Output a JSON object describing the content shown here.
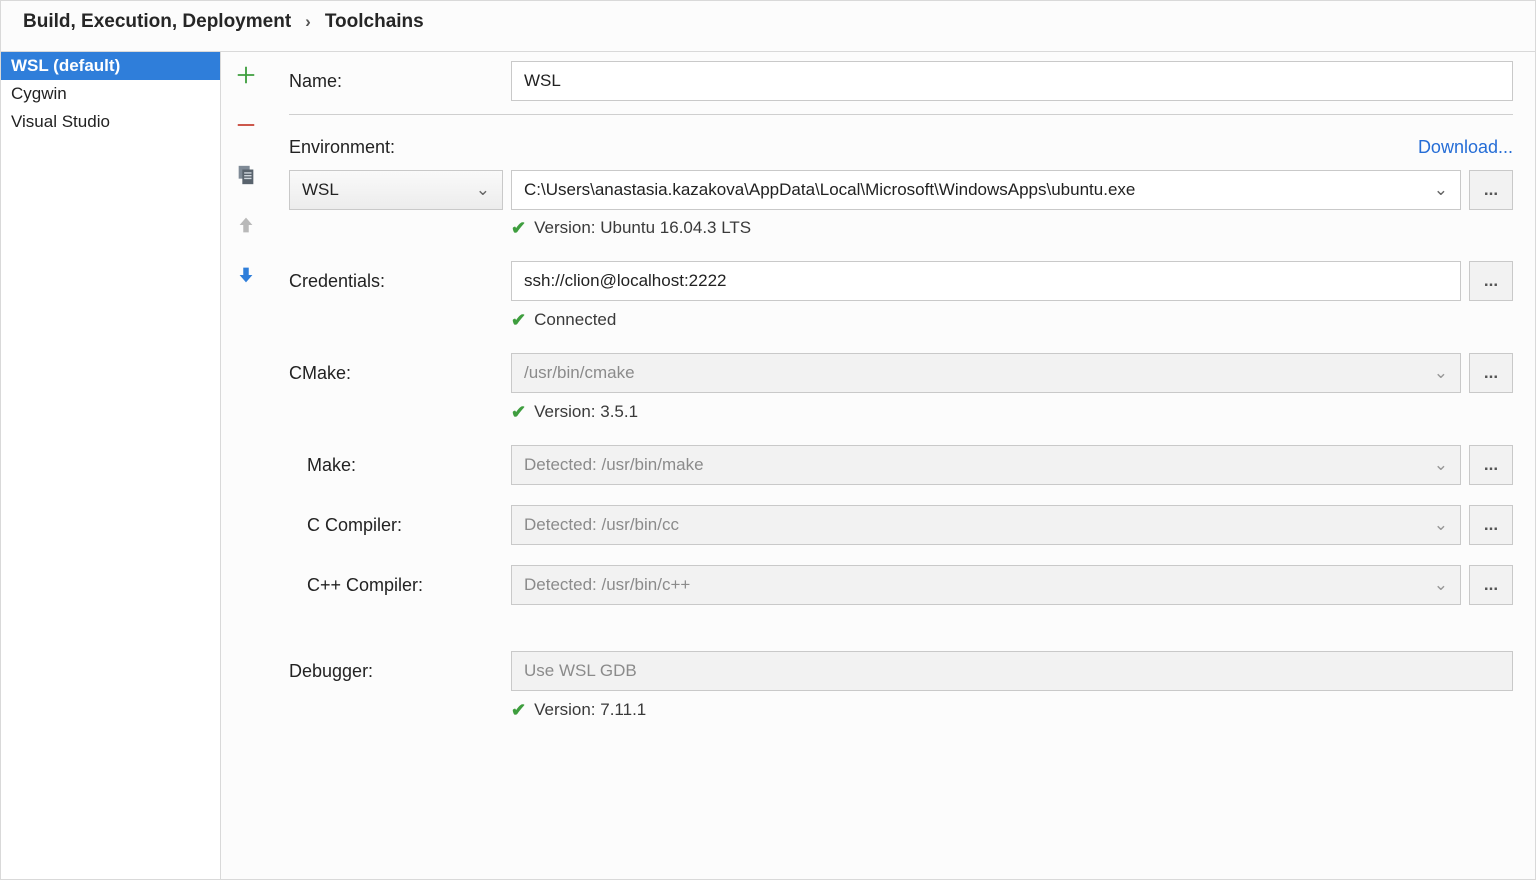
{
  "breadcrumb": {
    "root": "Build, Execution, Deployment",
    "leaf": "Toolchains"
  },
  "list": {
    "items": [
      {
        "label": "WSL (default)",
        "selected": true
      },
      {
        "label": "Cygwin",
        "selected": false
      },
      {
        "label": "Visual Studio",
        "selected": false
      }
    ]
  },
  "toolbar": {
    "add": "add-icon",
    "remove": "remove-icon",
    "copy": "copy-icon",
    "up": "up-icon",
    "down": "down-icon"
  },
  "form": {
    "name_label": "Name:",
    "name_value": "WSL",
    "environment_label": "Environment:",
    "download_label": "Download...",
    "env_type": "WSL",
    "env_path": "C:\\Users\\anastasia.kazakova\\AppData\\Local\\Microsoft\\WindowsApps\\ubuntu.exe",
    "env_status": "Version: Ubuntu 16.04.3 LTS",
    "credentials_label": "Credentials:",
    "credentials_value": "ssh://clion@localhost:2222",
    "credentials_status": "Connected",
    "cmake_label": "CMake:",
    "cmake_placeholder": "/usr/bin/cmake",
    "cmake_status": "Version: 3.5.1",
    "make_label": "Make:",
    "make_placeholder": "Detected: /usr/bin/make",
    "cc_label": "C Compiler:",
    "cc_placeholder": "Detected: /usr/bin/cc",
    "cxx_label": "C++ Compiler:",
    "cxx_placeholder": "Detected: /usr/bin/c++",
    "debugger_label": "Debugger:",
    "debugger_placeholder": "Use WSL GDB",
    "debugger_status": "Version: 7.11.1",
    "ellipsis": "...",
    "caret": "⌄"
  }
}
